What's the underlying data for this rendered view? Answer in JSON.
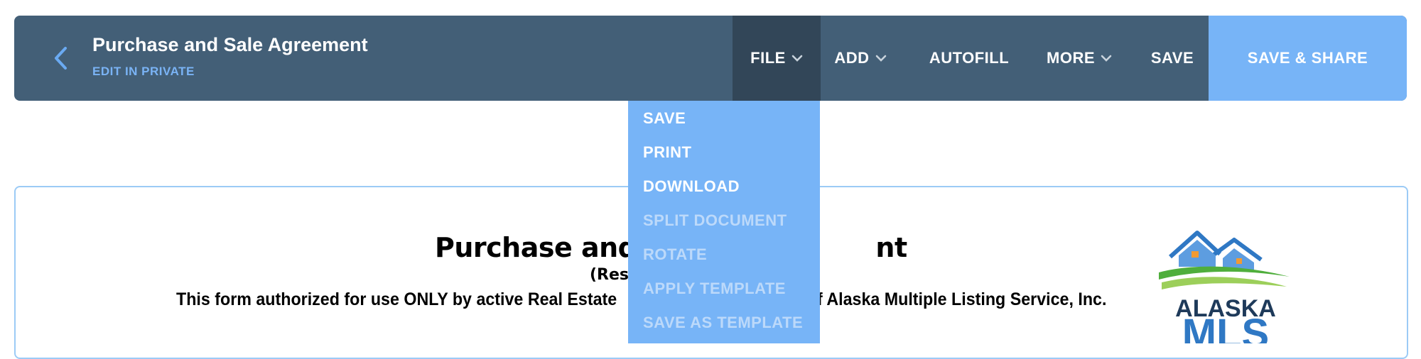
{
  "header": {
    "title": "Purchase and Sale Agreement",
    "subtitle": "EDIT IN PRIVATE"
  },
  "menu": {
    "file": "FILE",
    "add": "ADD",
    "autofill": "AUTOFILL",
    "more": "MORE",
    "save": "SAVE",
    "save_share": "SAVE & SHARE"
  },
  "file_dropdown": {
    "items": [
      {
        "label": "SAVE",
        "enabled": true
      },
      {
        "label": "PRINT",
        "enabled": true
      },
      {
        "label": "DOWNLOAD",
        "enabled": true
      },
      {
        "label": "SPLIT DOCUMENT",
        "enabled": false
      },
      {
        "label": "ROTATE",
        "enabled": false
      },
      {
        "label": "APPLY TEMPLATE",
        "enabled": false
      },
      {
        "label": "SAVE AS TEMPLATE",
        "enabled": false
      }
    ]
  },
  "document": {
    "heading_left": "Purchase and",
    "heading_right": "nt",
    "subheading": "(Res",
    "authorized_left": "This form authorized for use ONLY by active Real Estate",
    "authorized_right": "f Alaska Multiple Listing Service, Inc.",
    "logo_line1": "ALASKA",
    "logo_line2": "MLS"
  },
  "icons": {
    "back": "chevron-left-icon",
    "dropdown": "chevron-down-icon"
  },
  "colors": {
    "toolbar": "#435f77",
    "active_menu": "#324658",
    "accent": "#77b4f7",
    "link": "#7ab3f5"
  }
}
